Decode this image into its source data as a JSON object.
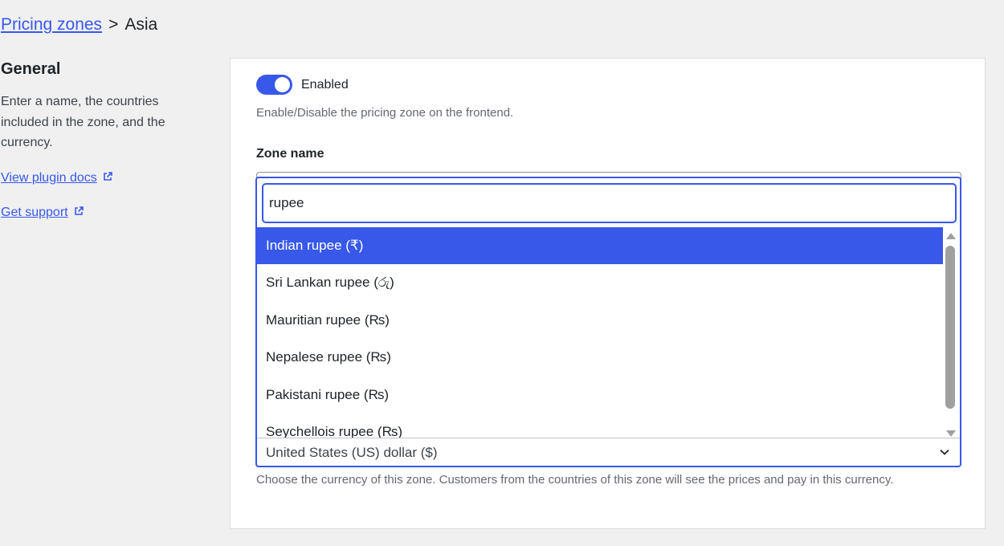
{
  "breadcrumb": {
    "parent": "Pricing zones",
    "separator": ">",
    "current": "Asia"
  },
  "sidebar": {
    "title": "General",
    "description": "Enter a name, the countries included in the zone, and the currency.",
    "links": [
      {
        "label": "View plugin docs",
        "icon": "external-link-icon"
      },
      {
        "label": "Get support",
        "icon": "external-link-icon"
      }
    ]
  },
  "enabled": {
    "label": "Enabled",
    "state": true,
    "help": "Enable/Disable the pricing zone on the frontend."
  },
  "zone_name": {
    "label": "Zone name"
  },
  "currency": {
    "search_value": "rupee",
    "options": [
      "Indian rupee (₹)",
      "Sri Lankan rupee (රු)",
      "Mauritian rupee (₨)",
      "Nepalese rupee (₨)",
      "Pakistani rupee (₨)",
      "Seychellois rupee (₨)"
    ],
    "highlighted_index": 0,
    "selected": "United States (US) dollar ($)",
    "help": "Choose the currency of this zone. Customers from the countries of this zone will see the prices and pay in this currency."
  },
  "colors": {
    "accent": "#3858e9",
    "background": "#f0f0f1",
    "card": "#ffffff",
    "help_text": "#646970"
  }
}
